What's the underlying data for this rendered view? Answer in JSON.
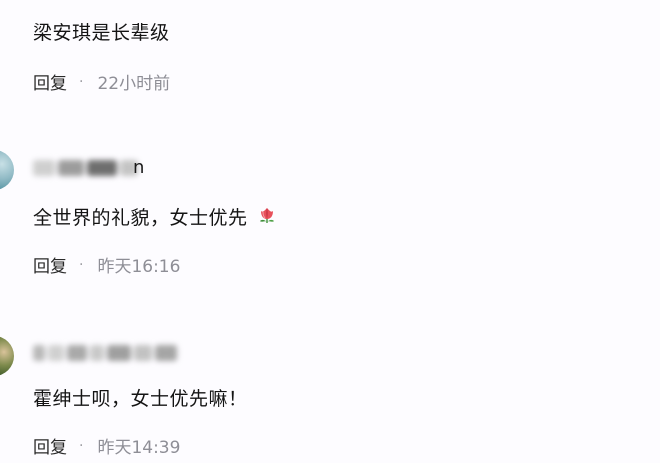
{
  "comments": [
    {
      "username_visible_suffix": "",
      "text": "梁安琪是长辈级",
      "reply_label": "回复",
      "separator": "·",
      "time": "22小时前"
    },
    {
      "username_visible_suffix": "n",
      "text": "全世界的礼貌，女士优先",
      "emoji": "tulip-icon",
      "reply_label": "回复",
      "separator": "·",
      "time": "昨天16:16"
    },
    {
      "username_visible_suffix": "",
      "text": "霍绅士呗，女士优先嘛！",
      "reply_label": "回复",
      "separator": "·",
      "time": "昨天14:39"
    }
  ],
  "colors": {
    "background": "#fdfcff",
    "text": "#141414",
    "meta": "#8e8e96"
  }
}
